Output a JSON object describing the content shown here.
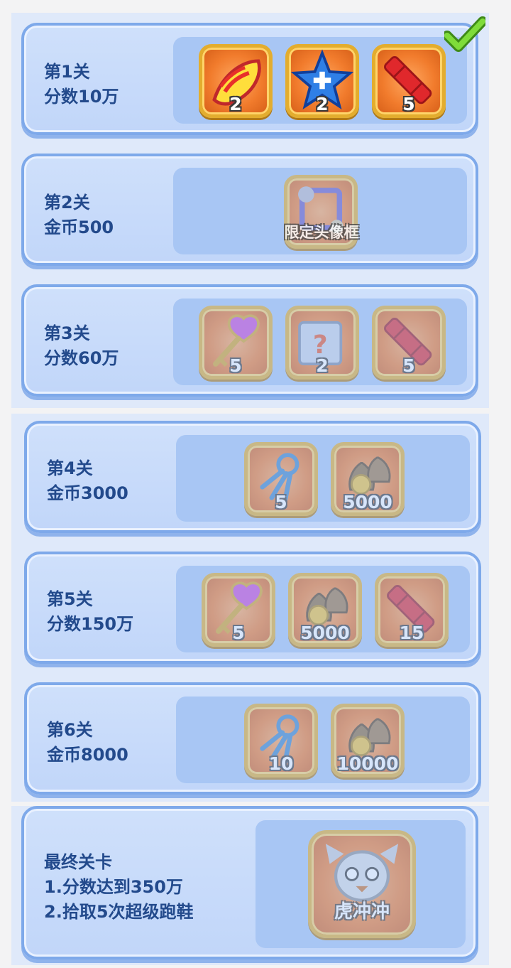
{
  "levels": [
    {
      "title": "第1关\n分数10万",
      "completed": true,
      "rewards": [
        {
          "icon": "fireball-boost-icon",
          "count": "2"
        },
        {
          "icon": "blue-star-boost-icon",
          "count": "2"
        },
        {
          "icon": "firecracker-icon",
          "count": "5"
        }
      ]
    },
    {
      "title": "第2关\n金币500",
      "rewards": [
        {
          "icon": "avatar-frame-icon",
          "label": "限定头像框"
        }
      ]
    },
    {
      "title": "第3关\n分数60万",
      "rewards": [
        {
          "icon": "heart-key-icon",
          "count": "5"
        },
        {
          "icon": "mystery-box-icon",
          "count": "2"
        },
        {
          "icon": "firecracker-icon",
          "count": "5"
        }
      ]
    },
    {
      "title": "第4关\n金币3000",
      "rewards": [
        {
          "icon": "key-bundle-icon",
          "count": "5"
        },
        {
          "icon": "coin-bags-icon",
          "count": "5000"
        }
      ]
    },
    {
      "title": "第5关\n分数150万",
      "rewards": [
        {
          "icon": "heart-key-icon",
          "count": "5"
        },
        {
          "icon": "coin-bags-icon",
          "count": "5000"
        },
        {
          "icon": "firecracker-icon",
          "count": "15"
        }
      ]
    },
    {
      "title": "第6关\n金币8000",
      "rewards": [
        {
          "icon": "key-bundle-icon",
          "count": "10"
        },
        {
          "icon": "coin-bags-icon",
          "count": "10000"
        }
      ]
    }
  ],
  "final": {
    "title": "最终关卡",
    "req1": "1.分数达到350万",
    "req2": "2.拾取5次超级跑鞋",
    "reward": {
      "icon": "tiger-character-icon",
      "label": "虎冲冲"
    }
  },
  "colors": {
    "accent_border": "#7ea9ea",
    "title_text": "#234a8c",
    "item_border": "#e3ad2e",
    "check_green": "#5dc02a"
  }
}
